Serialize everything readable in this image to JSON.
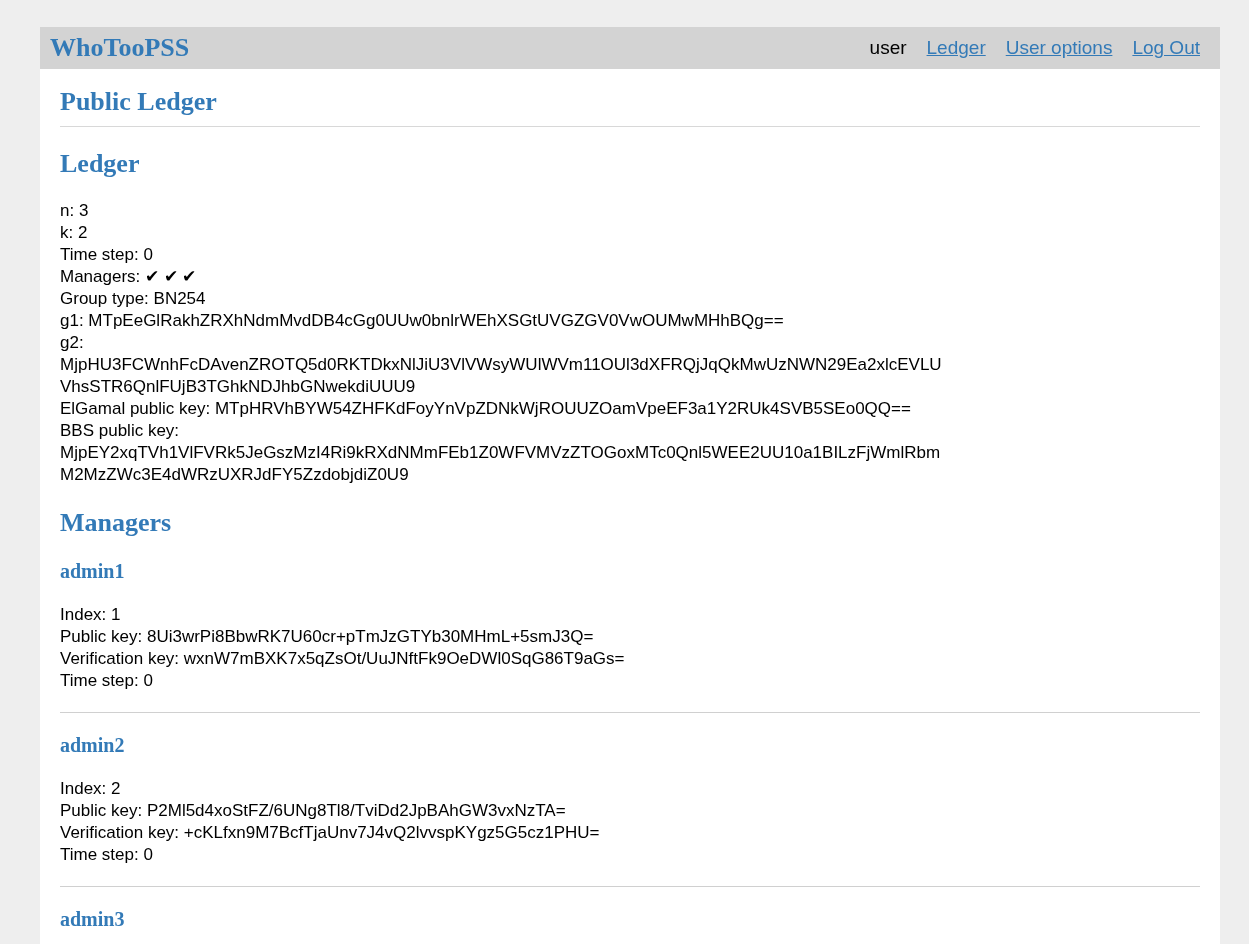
{
  "navbar": {
    "brand": "WhoTooPSS",
    "user": "user",
    "links": [
      "Ledger",
      "User options",
      "Log Out"
    ]
  },
  "page_title": "Public Ledger",
  "ledger": {
    "title": "Ledger",
    "fields": [
      {
        "kind": "inline",
        "label": "n:",
        "value": [
          "3"
        ]
      },
      {
        "kind": "inline",
        "label": "k:",
        "value": [
          "2"
        ]
      },
      {
        "kind": "inline",
        "label": "Time step:",
        "value": [
          "0"
        ]
      },
      {
        "kind": "inline",
        "label": "Managers:",
        "value": [
          "✔ ✔ ✔"
        ]
      },
      {
        "kind": "inline",
        "label": "Group type:",
        "value": [
          "BN254"
        ]
      },
      {
        "kind": "inline",
        "label": "g1:",
        "value": [
          "MTpEeGlRakhZRXhNdmMvdDB4cGg0UUw0bnlrWEhXSGtUVGZGV0VwOUMwMHhBQg=="
        ]
      },
      {
        "kind": "block",
        "label": "g2:",
        "value": [
          "MjpHU3FCWnhFcDAvenZROTQ5d0RKTDkxNlJiU3VlVWsyWUlWVm11OUl3dXFRQjJqQkMwUzNWN29Ea2xlcEVLU",
          "VhsSTR6QnlFUjB3TGhkNDJhbGNwekdiUUU9"
        ]
      },
      {
        "kind": "inline",
        "label": "ElGamal public key:",
        "value": [
          "MTpHRVhBYW54ZHFKdFoyYnVpZDNkWjROUUZOamVpeEF3a1Y2RUk4SVB5SEo0QQ=="
        ]
      },
      {
        "kind": "block",
        "label": "BBS public key:",
        "value": [
          "MjpEY2xqTVh1VlFVRk5JeGszMzI4Ri9kRXdNMmFEb1Z0WFVMVzZTOGoxMTc0Qnl5WEE2UU10a1BILzFjWmlRbm",
          "M2MzZWc3E4dWRzUXRJdFY5ZzdobjdiZ0U9"
        ]
      }
    ]
  },
  "managers": {
    "title": "Managers",
    "items": [
      {
        "name": "admin1",
        "fields": [
          {
            "label": "Index:",
            "value": "1"
          },
          {
            "label": "Public key:",
            "value": "8Ui3wrPi8BbwRK7U60cr+pTmJzGTYb30MHmL+5smJ3Q="
          },
          {
            "label": "Verification key:",
            "value": "wxnW7mBXK7x5qZsOt/UuJNftFk9OeDWl0SqG86T9aGs="
          },
          {
            "label": "Time step:",
            "value": "0"
          }
        ]
      },
      {
        "name": "admin2",
        "fields": [
          {
            "label": "Index:",
            "value": "2"
          },
          {
            "label": "Public key:",
            "value": "P2Ml5d4xoStFZ/6UNg8Tl8/TviDd2JpBAhGW3vxNzTA="
          },
          {
            "label": "Verification key:",
            "value": "+cKLfxn9M7BcfTjaUnv7J4vQ2lvvspKYgz5G5cz1PHU="
          },
          {
            "label": "Time step:",
            "value": "0"
          }
        ]
      },
      {
        "name": "admin3"
      }
    ]
  }
}
